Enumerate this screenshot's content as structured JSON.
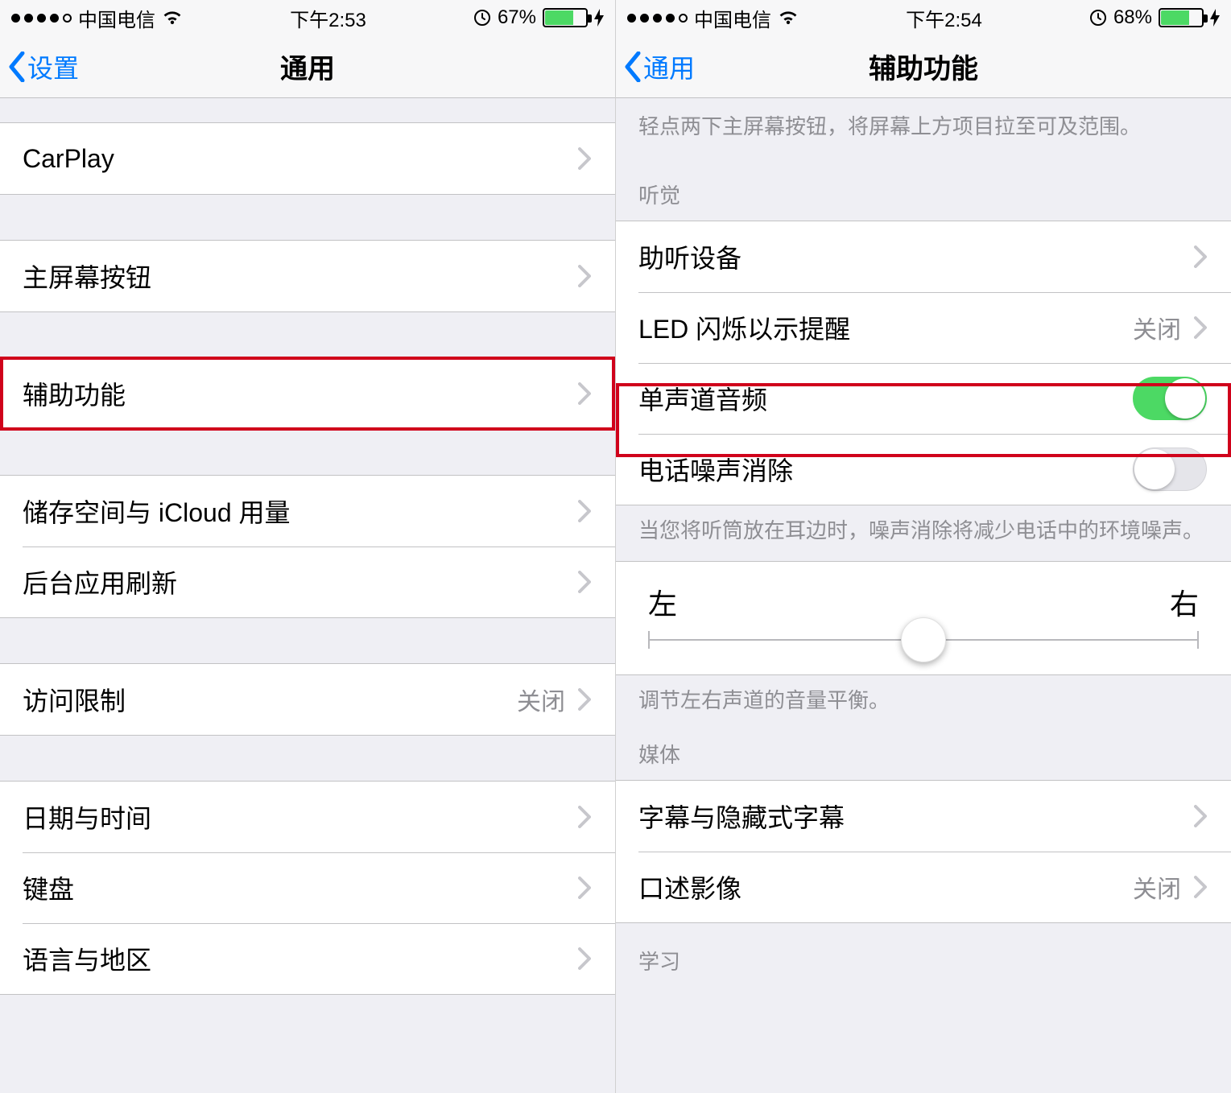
{
  "left": {
    "status": {
      "carrier": "中国电信",
      "time": "下午2:53",
      "battery_pct": "67%",
      "battery_fill_pct": 67
    },
    "nav": {
      "back": "设置",
      "title": "通用"
    },
    "rows": {
      "carplay": "CarPlay",
      "home_button": "主屏幕按钮",
      "accessibility": "辅助功能",
      "storage_icloud": "储存空间与 iCloud 用量",
      "bg_refresh": "后台应用刷新",
      "restrictions": "访问限制",
      "restrictions_value": "关闭",
      "date_time": "日期与时间",
      "keyboard": "键盘",
      "language_region": "语言与地区"
    }
  },
  "right": {
    "status": {
      "carrier": "中国电信",
      "time": "下午2:54",
      "battery_pct": "68%",
      "battery_fill_pct": 68
    },
    "nav": {
      "back": "通用",
      "title": "辅助功能"
    },
    "note_top": "轻点两下主屏幕按钮，将屏幕上方项目拉至可及范围。",
    "section_hearing": "听觉",
    "rows": {
      "hearing_devices": "助听设备",
      "led_flash": "LED 闪烁以示提醒",
      "led_flash_value": "关闭",
      "mono_audio": "单声道音频",
      "noise_cancel": "电话噪声消除"
    },
    "note_noise": "当您将听筒放在耳边时，噪声消除将减少电话中的环境噪声。",
    "slider": {
      "left": "左",
      "right": "右"
    },
    "note_balance": "调节左右声道的音量平衡。",
    "section_media": "媒体",
    "rows2": {
      "subtitles": "字幕与隐藏式字幕",
      "audio_desc": "口述影像",
      "audio_desc_value": "关闭"
    },
    "section_learning": "学习"
  }
}
